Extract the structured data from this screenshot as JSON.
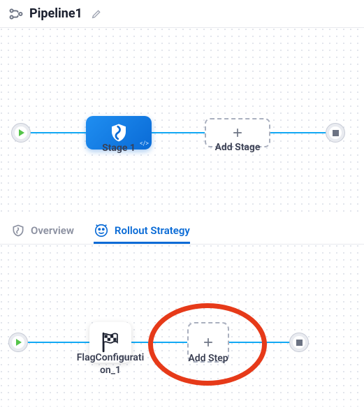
{
  "header": {
    "title": "Pipeline1"
  },
  "upper": {
    "stage_label": "Stage 1",
    "add_stage_label": "Add Stage"
  },
  "tabs": {
    "overview": "Overview",
    "rollout": "Rollout Strategy"
  },
  "lower": {
    "step_label": "FlagConfiguration_1",
    "add_step_label": "Add Step"
  }
}
